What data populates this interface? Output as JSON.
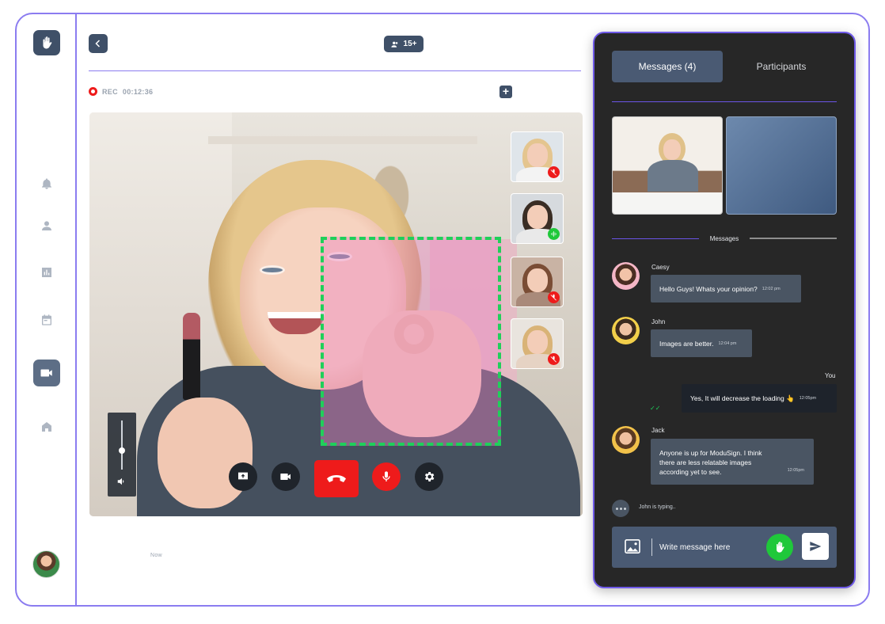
{
  "header": {
    "participants_count": "15+",
    "rec_label": "REC",
    "rec_time": "00:12:36"
  },
  "video": {
    "timestamp": "Now"
  },
  "chat": {
    "tabs": [
      {
        "label": "Messages (4)",
        "active": true
      },
      {
        "label": "Participants",
        "active": false
      }
    ],
    "section_label": "Messages",
    "messages": [
      {
        "sender": "Caesy",
        "text": "Hello Guys! Whats your opinion?",
        "time": "12:02 pm"
      },
      {
        "sender": "John",
        "text": "Images are better.",
        "time": "12:04 pm"
      },
      {
        "sender": "You",
        "text": "Yes, It will decrease the loading 👆",
        "time": "12:05pm"
      },
      {
        "sender": "Jack",
        "text": "Anyone is up for ModuSign. I think there are less relatable images according yet to see.",
        "time": "12:05pm"
      }
    ],
    "typing": "John is typing..",
    "composer_placeholder": "Write message here"
  },
  "colors": {
    "accent_purple": "#8b7cf0",
    "slate": "#3f5068",
    "danger": "#ee1b1b",
    "success": "#1fd05a",
    "panel_bg": "#272727"
  },
  "icons": [
    "hand-logo-icon",
    "bell-icon",
    "user-icon",
    "chart-icon",
    "calendar-icon",
    "video-icon",
    "home-icon",
    "chevron-left-icon",
    "people-icon",
    "plus-icon",
    "volume-icon",
    "share-screen-icon",
    "camera-icon",
    "end-call-icon",
    "mic-icon",
    "settings-icon",
    "mic-off-icon",
    "sound-wave-icon",
    "image-icon",
    "send-icon"
  ]
}
